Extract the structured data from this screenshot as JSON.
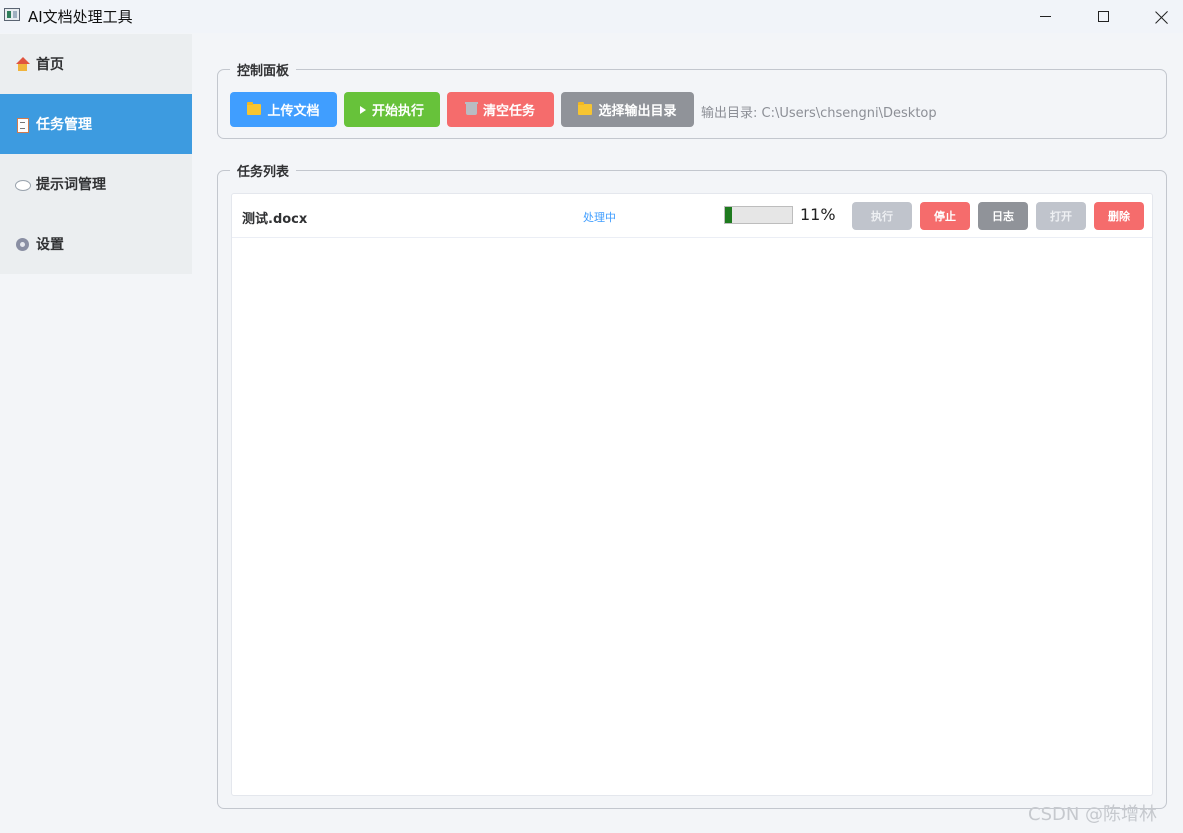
{
  "window": {
    "title": "AI文档处理工具",
    "minimize_icon": "minimize-icon",
    "maximize_icon": "maximize-icon",
    "close_icon": "close-icon"
  },
  "sidebar": {
    "items": [
      {
        "label": "首页",
        "icon": "home-icon",
        "active": false
      },
      {
        "label": "任务管理",
        "icon": "task-icon",
        "active": true
      },
      {
        "label": "提示词管理",
        "icon": "speech-bubble-icon",
        "active": false
      },
      {
        "label": "设置",
        "icon": "gear-icon",
        "active": false
      }
    ]
  },
  "control_panel": {
    "title": "控制面板",
    "upload_label": "上传文档",
    "start_label": "开始执行",
    "clear_label": "清空任务",
    "output_dir_label": "选择输出目录",
    "output_dir_text": "输出目录: C:\\Users\\chsengni\\Desktop",
    "colors": {
      "upload": "#409eff",
      "start": "#67c23a",
      "clear": "#f56c6c",
      "output": "#909399"
    }
  },
  "task_list": {
    "title": "任务列表",
    "tasks": [
      {
        "name": "测试.docx",
        "status": "处理中",
        "progress": 0.11,
        "progress_text": "11%",
        "buttons": {
          "execute": "执行",
          "stop": "停止",
          "log": "日志",
          "open": "打开",
          "delete": "删除"
        }
      }
    ]
  },
  "watermark": "CSDN @陈增林"
}
